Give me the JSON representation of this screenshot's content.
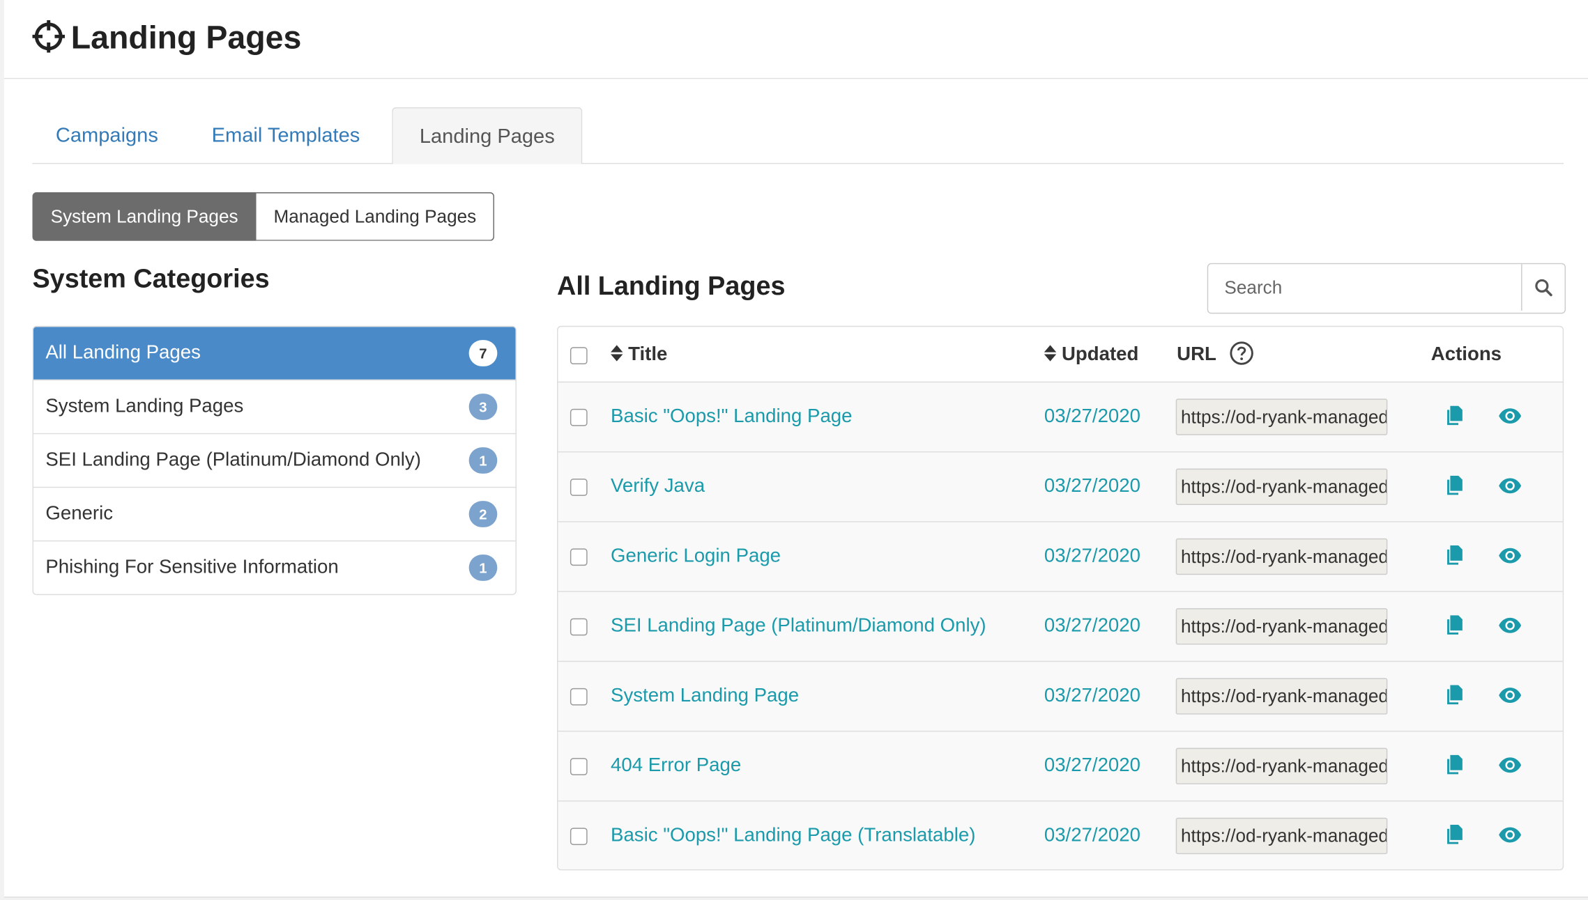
{
  "header": {
    "title": "Landing Pages",
    "icon": "crosshairs-icon"
  },
  "tabs": [
    {
      "label": "Campaigns",
      "active": false
    },
    {
      "label": "Email Templates",
      "active": false
    },
    {
      "label": "Landing Pages",
      "active": true
    }
  ],
  "toggle": {
    "system_label": "System Landing Pages",
    "managed_label": "Managed Landing Pages",
    "selected": "System Landing Pages"
  },
  "sidebar": {
    "title": "System Categories",
    "items": [
      {
        "label": "All Landing Pages",
        "count": "7",
        "active": true
      },
      {
        "label": "System Landing Pages",
        "count": "3",
        "active": false
      },
      {
        "label": "SEI Landing Page (Platinum/Diamond Only)",
        "count": "1",
        "active": false
      },
      {
        "label": "Generic",
        "count": "2",
        "active": false
      },
      {
        "label": "Phishing For Sensitive Information",
        "count": "1",
        "active": false
      }
    ]
  },
  "main": {
    "title": "All Landing Pages",
    "search": {
      "placeholder": "Search",
      "value": ""
    },
    "table": {
      "columns": {
        "title": "Title",
        "updated": "Updated",
        "url": "URL",
        "actions": "Actions"
      },
      "rows": [
        {
          "title": "Basic \"Oops!\" Landing Page",
          "updated": "03/27/2020",
          "url": "https://od-ryank-managed"
        },
        {
          "title": "Verify Java",
          "updated": "03/27/2020",
          "url": "https://od-ryank-managed"
        },
        {
          "title": "Generic Login Page",
          "updated": "03/27/2020",
          "url": "https://od-ryank-managed"
        },
        {
          "title": "SEI Landing Page (Platinum/Diamond Only)",
          "updated": "03/27/2020",
          "url": "https://od-ryank-managed"
        },
        {
          "title": "System Landing Page",
          "updated": "03/27/2020",
          "url": "https://od-ryank-managed"
        },
        {
          "title": "404 Error Page",
          "updated": "03/27/2020",
          "url": "https://od-ryank-managed"
        },
        {
          "title": "Basic \"Oops!\" Landing Page (Translatable)",
          "updated": "03/27/2020",
          "url": "https://od-ryank-managed"
        }
      ]
    }
  },
  "colors": {
    "link": "#337ab7",
    "teal": "#1a9aaa",
    "active_list": "#4a8ac8",
    "badge": "#7ba3cd"
  }
}
